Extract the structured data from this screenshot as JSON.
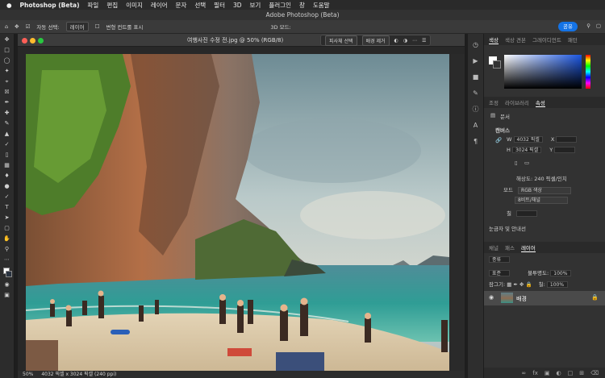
{
  "menubar": {
    "apple": "",
    "app": "Photoshop (Beta)",
    "items": [
      "파일",
      "편집",
      "이미지",
      "레이어",
      "문자",
      "선택",
      "필터",
      "3D",
      "보기",
      "플러그인",
      "창",
      "도움말"
    ]
  },
  "window": {
    "title": "Adobe Photoshop (Beta)"
  },
  "options": {
    "auto_select": "자동 선택:",
    "layer": "레이어",
    "transform": "변형 컨트롤 표시",
    "mode3d": "3D 모드:",
    "share": "공유"
  },
  "document": {
    "title": "여행사진 수정 전.jpg @ 50% (RGB/8)",
    "ctx_subject": "피사체 선택",
    "ctx_remove_bg": "배경 제거"
  },
  "status": {
    "zoom": "50%",
    "size": "4032 픽셀 x 3024 픽셀 (240 ppi)"
  },
  "panels": {
    "color_tabs": [
      "색상",
      "색상 견본",
      "그레이디언트",
      "패턴"
    ],
    "adj_tabs": [
      "조정",
      "라이브러리",
      "속성"
    ],
    "doc_label": "문서",
    "canvas_header": "캔버스",
    "w_label": "W",
    "w_value": "4032 픽셀",
    "x_label": "X",
    "h_label": "H",
    "h_value": "3024 픽셀",
    "y_label": "Y",
    "resolution": "해상도: 240 픽셀/인치",
    "mode_label": "모드",
    "mode_value": "RGB 색상",
    "depth_value": "8비트/채널",
    "fill_label": "칠",
    "rulers": "눈금자 및 안내선",
    "layer_tabs": [
      "채널",
      "패스",
      "레이어"
    ],
    "kind": "종류",
    "blend": "표준",
    "opacity_label": "불투명도:",
    "opacity_value": "100%",
    "lock_label": "잠그기:",
    "fill2_label": "칠:",
    "fill2_value": "100%",
    "layer_name": "배경"
  },
  "colors": {
    "accent": "#1473e6",
    "fg": "#ffffff",
    "bg": "#333333"
  }
}
